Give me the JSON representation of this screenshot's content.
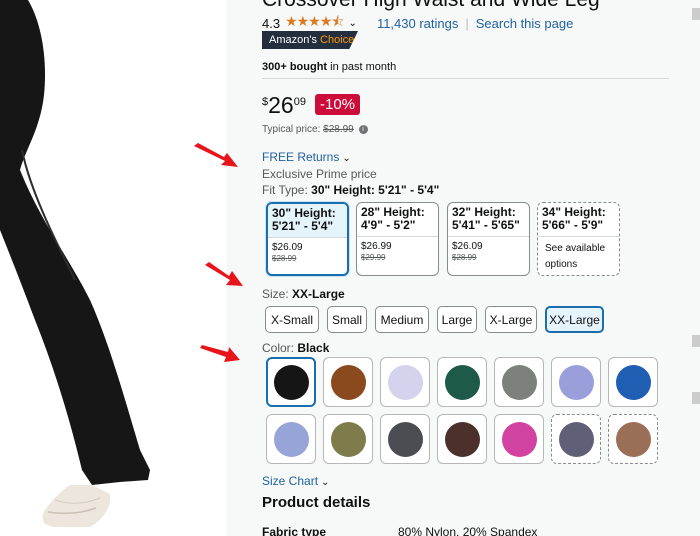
{
  "product": {
    "title": "Crossover High Waist and Wide Leg",
    "rating": "4.3",
    "stars": "★★★★⯪",
    "ratings_count": "11,430 ratings",
    "search_page": "Search this page",
    "separator": "|",
    "choice_badge_1": "Amazon's",
    "choice_badge_2": "Choice",
    "bought_bold": "300+ bought",
    "bought_rest": " in past month"
  },
  "price": {
    "currency": "$",
    "whole": "26",
    "fraction": "09",
    "discount": "-10%",
    "typical_label": "Typical price: ",
    "typical_value": "$28.99",
    "info_icon": "i"
  },
  "delivery": {
    "free_returns": "FREE Returns",
    "chevron": "⌄",
    "exclusive": "Exclusive Prime price"
  },
  "fit": {
    "label": "Fit Type: ",
    "selected": "30\" Height: 5'21\" - 5'4\"",
    "options": [
      {
        "title_1": "30\" Height:",
        "title_2": "5'21\" - 5'4\"",
        "price": "$26.09",
        "old": "$28.99"
      },
      {
        "title_1": "28\" Height:",
        "title_2": "4'9\" - 5'2\"",
        "price": "$26.99",
        "old": "$29.99"
      },
      {
        "title_1": "32\" Height:",
        "title_2": "5'41\" - 5'65\"",
        "price": "$26.09",
        "old": "$28.99"
      },
      {
        "title_1": "34\" Height:",
        "title_2": "5'66\" - 5'9\"",
        "see_1": "See available",
        "see_2": "options"
      }
    ]
  },
  "size": {
    "label": "Size: ",
    "selected": "XX-Large",
    "options": [
      "X-Small",
      "Small",
      "Medium",
      "Large",
      "X-Large",
      "XX-Large"
    ]
  },
  "color": {
    "label": "Color: ",
    "selected": "Black",
    "swatches": [
      "#151515",
      "#8a4a1d",
      "#d4d2ec",
      "#1e5a4a",
      "#7d817c",
      "#9a9fdc",
      "#1f5fb3",
      "#96a4d8",
      "#7e7c4a",
      "#4c4d52",
      "#4b302c",
      "#d242a0",
      "#5f6078",
      "#9b6e58"
    ]
  },
  "footer": {
    "size_chart": "Size Chart",
    "details_title": "Product details",
    "fabric_key": "Fabric type",
    "fabric_value": "80% Nylon, 20% Spandex"
  },
  "colors": {
    "arrow": "#e8141c",
    "link": "#2162a1",
    "selected_border": "#1b6eae",
    "badge_bg": "#232f3e",
    "deal_red": "#cc0c39",
    "star": "#de7921"
  }
}
